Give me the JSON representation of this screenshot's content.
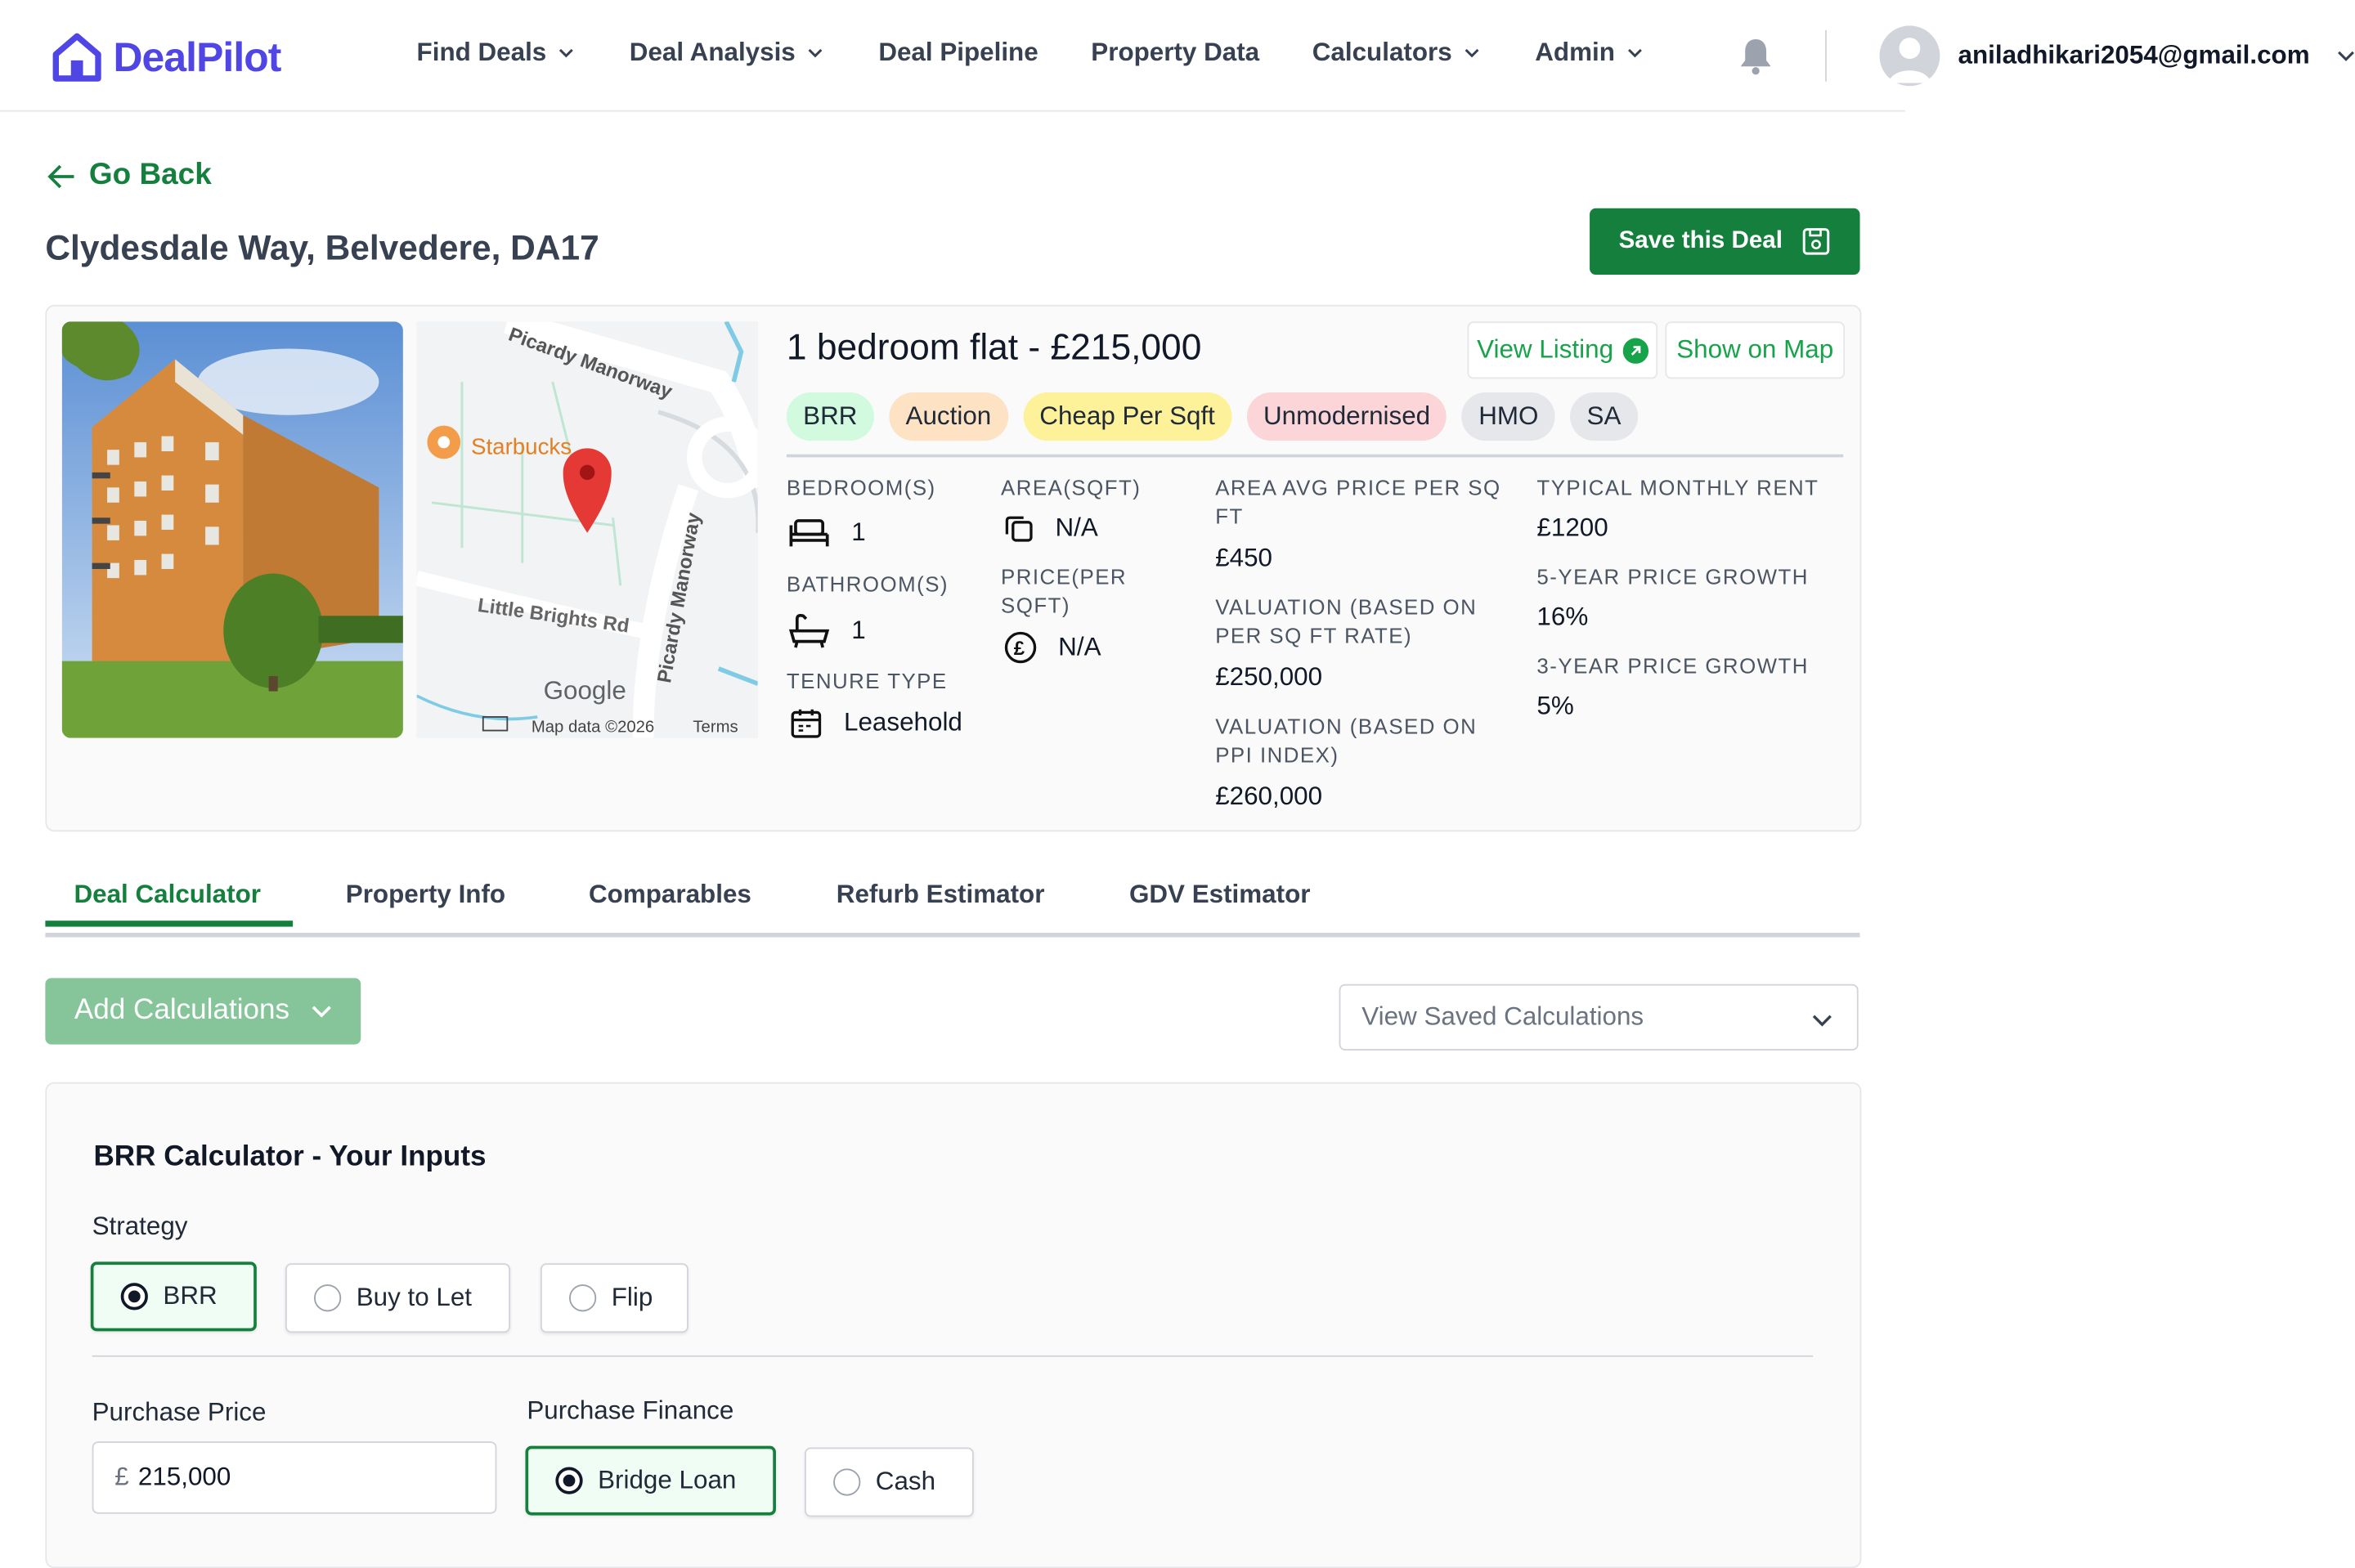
{
  "brand": {
    "name": "DealPilot",
    "color": "#4f46e5",
    "icon": "house-logo-icon"
  },
  "nav": {
    "items": [
      {
        "label": "Find Deals",
        "dropdown": true
      },
      {
        "label": "Deal Analysis",
        "dropdown": true
      },
      {
        "label": "Deal Pipeline",
        "dropdown": false
      },
      {
        "label": "Property Data",
        "dropdown": false
      },
      {
        "label": "Calculators",
        "dropdown": true
      },
      {
        "label": "Admin",
        "dropdown": true
      }
    ],
    "user_email": "aniladhikari2054@gmail.com"
  },
  "page": {
    "go_back": "Go Back",
    "title": "Clydesdale Way, Belvedere, DA17",
    "save_button": "Save this Deal"
  },
  "property": {
    "headline_type": "1 bedroom flat",
    "headline_sep": "-",
    "headline_price": "£215,000",
    "view_listing": "View Listing",
    "show_on_map": "Show on Map",
    "tags": [
      {
        "label": "BRR",
        "color": "#d1fadf"
      },
      {
        "label": "Auction",
        "color": "#fde2c4"
      },
      {
        "label": "Cheap Per Sqft",
        "color": "#fdf19a"
      },
      {
        "label": "Unmodernised",
        "color": "#fbd5d8"
      },
      {
        "label": "HMO",
        "color": "#e5e7eb"
      },
      {
        "label": "SA",
        "color": "#e5e7eb"
      }
    ],
    "stats": {
      "bedrooms_label": "BEDROOM(S)",
      "bedrooms": "1",
      "bathrooms_label": "BATHROOM(S)",
      "bathrooms": "1",
      "tenure_label": "TENURE TYPE",
      "tenure": "Leasehold",
      "area_label": "AREA(SQFT)",
      "area": "N/A",
      "price_per_sqft_label_1": "PRICE(PER",
      "price_per_sqft_label_2": "SQFT)",
      "price_per_sqft": "N/A",
      "area_avg_label_1": "AREA AVG PRICE PER SQ",
      "area_avg_label_2": "FT",
      "area_avg": "£450",
      "valuation_sqft_label_1": "VALUATION (BASED ON",
      "valuation_sqft_label_2": "PER SQ FT RATE)",
      "valuation_sqft": "£250,000",
      "valuation_ppi_label_1": "VALUATION (BASED ON",
      "valuation_ppi_label_2": "PPI INDEX)",
      "valuation_ppi": "£260,000",
      "rent_label": "TYPICAL MONTHLY RENT",
      "rent": "£1200",
      "growth5_label": "5-YEAR PRICE GROWTH",
      "growth5": "16%",
      "growth3_label": "3-YEAR PRICE GROWTH",
      "growth3": "5%"
    },
    "map": {
      "poi": "Starbucks",
      "road_top": "Picardy Manorway",
      "road_side": "Picardy Manorway",
      "road_little": "Little Brights Rd",
      "google": "Google",
      "map_data": "Map data ©2026",
      "terms": "Terms"
    }
  },
  "tabs": [
    "Deal Calculator",
    "Property Info",
    "Comparables",
    "Refurb Estimator",
    "GDV Estimator"
  ],
  "actions": {
    "add_calculations": "Add Calculations",
    "view_saved": "View Saved Calculations"
  },
  "calculator": {
    "title": "BRR Calculator - Your Inputs",
    "strategy_label": "Strategy",
    "strategies": [
      {
        "label": "BRR",
        "selected": true
      },
      {
        "label": "Buy to Let",
        "selected": false
      },
      {
        "label": "Flip",
        "selected": false
      }
    ],
    "purchase_price_label": "Purchase Price",
    "currency": "£",
    "purchase_price": "215,000",
    "purchase_finance_label": "Purchase Finance",
    "finance_options": [
      {
        "label": "Bridge Loan",
        "selected": true
      },
      {
        "label": "Cash",
        "selected": false
      }
    ]
  },
  "colors": {
    "accent": "#15803d",
    "link": "#16a34a"
  }
}
